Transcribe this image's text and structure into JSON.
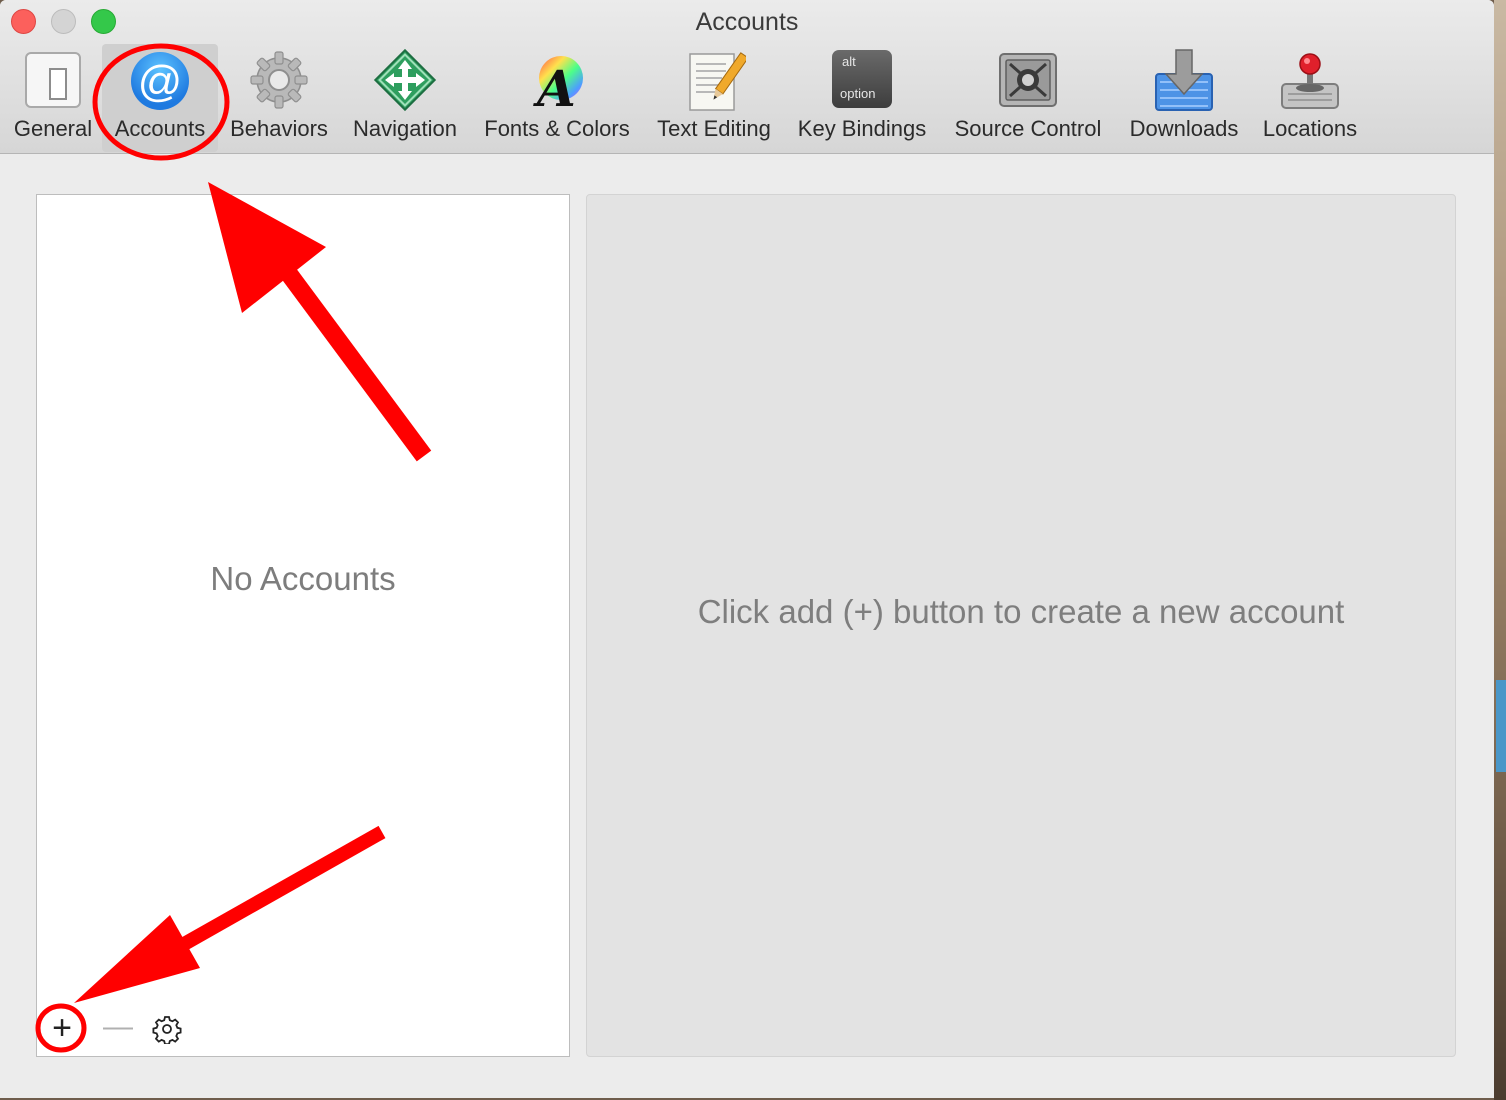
{
  "window": {
    "title": "Accounts"
  },
  "toolbar": {
    "items": [
      {
        "label": "General",
        "icon": "toggle-switch-icon"
      },
      {
        "label": "Accounts",
        "icon": "at-sign-icon",
        "selected": true
      },
      {
        "label": "Behaviors",
        "icon": "gear-icon"
      },
      {
        "label": "Navigation",
        "icon": "move-arrows-icon"
      },
      {
        "label": "Fonts & Colors",
        "icon": "font-color-wheel-icon"
      },
      {
        "label": "Text Editing",
        "icon": "paper-pencil-icon"
      },
      {
        "label": "Key Bindings",
        "icon": "option-key-icon",
        "key_top": "alt",
        "key_bottom": "option"
      },
      {
        "label": "Source Control",
        "icon": "vault-safe-icon"
      },
      {
        "label": "Downloads",
        "icon": "download-arrow-icon"
      },
      {
        "label": "Locations",
        "icon": "joystick-drive-icon"
      }
    ]
  },
  "sidebar": {
    "empty_text": "No Accounts",
    "add_label": "+",
    "remove_label": "—"
  },
  "detail": {
    "hint": "Click add (+) button to create a new account"
  },
  "colors": {
    "annotation_red": "#ff0000",
    "accent_blue": "#1f7ae0",
    "close": "#fc605c",
    "minimize": "#d4d4d4",
    "zoom": "#34c84a"
  }
}
